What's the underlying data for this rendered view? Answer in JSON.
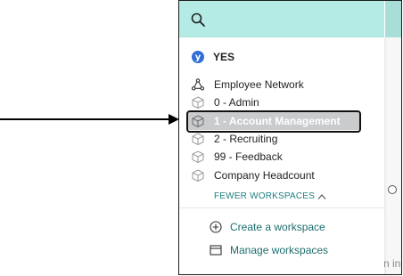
{
  "search": {
    "icon": "search-icon"
  },
  "org": {
    "badge": "y",
    "name": "YES"
  },
  "workspaces": [
    {
      "label": "Employee Network",
      "icon": "network-icon",
      "selected": false
    },
    {
      "label": "0 - Admin",
      "icon": "cube-icon",
      "selected": false
    },
    {
      "label": "1 - Account Management",
      "icon": "cube-icon",
      "selected": true
    },
    {
      "label": "2 - Recruiting",
      "icon": "cube-icon",
      "selected": false
    },
    {
      "label": "99 - Feedback",
      "icon": "cube-icon",
      "selected": false
    },
    {
      "label": "Company Headcount",
      "icon": "cube-icon",
      "selected": false
    }
  ],
  "toggle": {
    "label": "FEWER WORKSPACES",
    "icon": "chevron-up-icon"
  },
  "actions": [
    {
      "label": "Create a workspace",
      "icon": "plus-circle-icon"
    },
    {
      "label": "Manage workspaces",
      "icon": "window-icon"
    }
  ],
  "background": {
    "partial_text": "n inc"
  },
  "colors": {
    "accent": "#b4ece5",
    "link": "#1d6e6e",
    "selected": "#c9cbcd"
  }
}
